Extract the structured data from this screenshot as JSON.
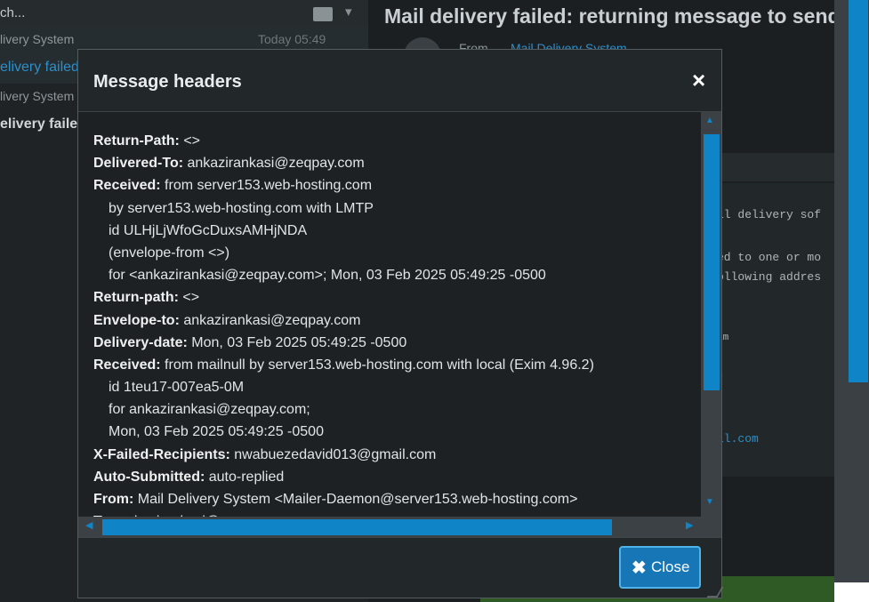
{
  "search": {
    "placeholder_fragment": "ch..."
  },
  "message_list": [
    {
      "sender": "livery System",
      "date": "Today 05:49",
      "subject": "elivery failed",
      "selected": true
    },
    {
      "sender": "livery System",
      "date": "",
      "subject": "elivery failed",
      "selected": false
    }
  ],
  "reading_pane": {
    "title": "Mail delivery failed: returning message to sender",
    "from_label": "From",
    "from_value": "Mail Delivery System",
    "body_fragments": [
      "il delivery sof",
      "ed to one or mo",
      "ollowing addres",
      "am",
      "m",
      "il.com"
    ]
  },
  "dialog": {
    "title": "Message headers",
    "close_x": "×",
    "close_button": {
      "icon": "✖",
      "label": "Close"
    },
    "headers": [
      {
        "name": "Return-Path:",
        "value": " <>"
      },
      {
        "name": "Delivered-To:",
        "value": " ankazirankasi@zeqpay.com"
      },
      {
        "name": "Received:",
        "value": " from server153.web-hosting.com"
      },
      {
        "name": "",
        "value": "by server153.web-hosting.com with LMTP"
      },
      {
        "name": "",
        "value": "id ULHjLjWfoGcDuxsAMHjNDA"
      },
      {
        "name": "",
        "value": "(envelope-from <>)"
      },
      {
        "name": "",
        "value": "for <ankazirankasi@zeqpay.com>; Mon, 03 Feb 2025 05:49:25 -0500"
      },
      {
        "name": "Return-path:",
        "value": " <>"
      },
      {
        "name": "Envelope-to:",
        "value": " ankazirankasi@zeqpay.com"
      },
      {
        "name": "Delivery-date:",
        "value": " Mon, 03 Feb 2025 05:49:25 -0500"
      },
      {
        "name": "Received:",
        "value": " from mailnull by server153.web-hosting.com with local (Exim 4.96.2)"
      },
      {
        "name": "",
        "value": "id 1teu17-007ea5-0M"
      },
      {
        "name": "",
        "value": "for ankazirankasi@zeqpay.com;"
      },
      {
        "name": "",
        "value": "Mon, 03 Feb 2025 05:49:25 -0500"
      },
      {
        "name": "X-Failed-Recipients:",
        "value": " nwabuezedavid013@gmail.com"
      },
      {
        "name": "Auto-Submitted:",
        "value": " auto-replied"
      },
      {
        "name": "From:",
        "value": " Mail Delivery System <Mailer-Daemon@server153.web-hosting.com>"
      },
      {
        "name": "To:",
        "value": " ankazirankasi@zeqpay.com"
      }
    ]
  },
  "colors": {
    "accent": "#0f84c6",
    "button": "#1776b6",
    "link": "#2c8fc9",
    "background": "#1e2224"
  }
}
